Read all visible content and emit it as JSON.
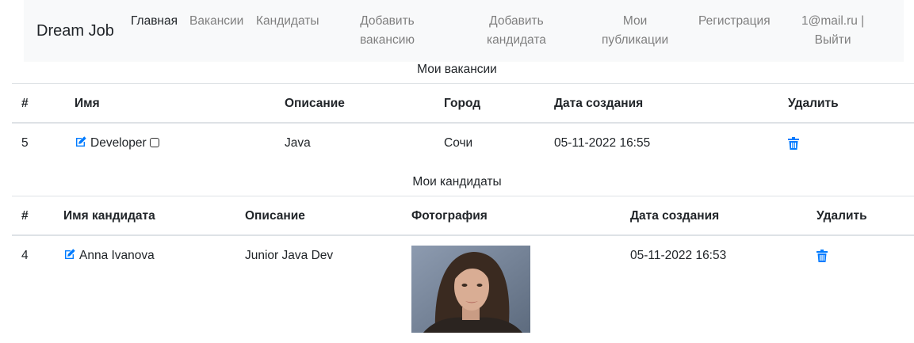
{
  "navbar": {
    "brand": "Dream Job",
    "links": [
      {
        "line1": "Главная",
        "line2": ""
      },
      {
        "line1": "Вакансии",
        "line2": ""
      },
      {
        "line1": "Кандидаты",
        "line2": ""
      },
      {
        "line1": "Добавить",
        "line2": "вакансию"
      },
      {
        "line1": "Добавить",
        "line2": "кандидата"
      },
      {
        "line1": "Мои",
        "line2": "публикации"
      },
      {
        "line1": "Регистрация",
        "line2": ""
      },
      {
        "line1": "1@mail.ru |",
        "line2": "Выйти"
      }
    ]
  },
  "vacancies": {
    "title": "Мои вакансии",
    "headers": [
      "#",
      "Имя",
      "Описание",
      "Город",
      "Дата создания",
      "Удалить"
    ],
    "rows": [
      {
        "id": "5",
        "name": "Developer",
        "description": "Java",
        "city": "Сочи",
        "created": "05-11-2022 16:55"
      }
    ]
  },
  "candidates": {
    "title": "Мои кандидаты",
    "headers": [
      "#",
      "Имя кандидата",
      "Описание",
      "Фотография",
      "Дата создания",
      "Удалить"
    ],
    "rows": [
      {
        "id": "4",
        "name": "Anna Ivanova",
        "description": "Junior Java Dev",
        "created": "05-11-2022 16:53"
      }
    ]
  },
  "colors": {
    "accent": "#007bff",
    "navbar_bg": "#f8f9fa",
    "muted": "#7f7f7f",
    "border": "#dee2e6"
  },
  "icons": {
    "edit": "edit-icon",
    "delete": "trash-icon",
    "checkbox": "checkbox-icon"
  }
}
